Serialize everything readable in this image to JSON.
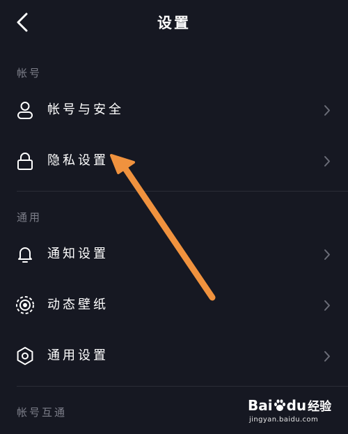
{
  "header": {
    "title": "设置"
  },
  "sections": {
    "account": {
      "title": "帐号",
      "items": [
        {
          "label": "帐号与安全",
          "icon": "user-icon"
        },
        {
          "label": "隐私设置",
          "icon": "lock-icon"
        }
      ]
    },
    "general": {
      "title": "通用",
      "items": [
        {
          "label": "通知设置",
          "icon": "bell-icon"
        },
        {
          "label": "动态壁纸",
          "icon": "live-wallpaper-icon"
        },
        {
          "label": "通用设置",
          "icon": "gear-icon"
        }
      ]
    },
    "interop": {
      "title": "帐号互通"
    }
  },
  "annotation": {
    "color": "#f0923e"
  },
  "watermark": {
    "brand_bai": "Bai",
    "brand_du": "du",
    "brand_jingyan": "经验",
    "url": "jingyan.baidu.com"
  },
  "colors": {
    "background": "#161822",
    "text": "#ffffff",
    "section_text": "#7d7f8a",
    "chevron": "#6b6d78",
    "divider": "#2a2c37"
  }
}
